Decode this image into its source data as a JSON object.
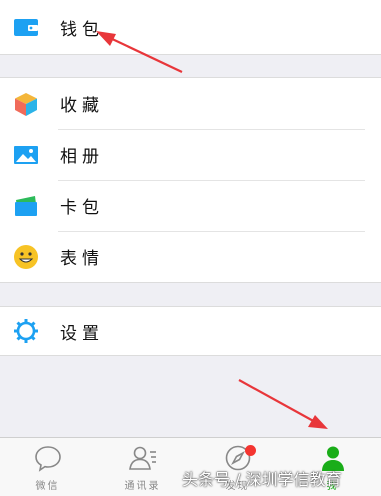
{
  "menu": {
    "wallet": {
      "label": "钱包",
      "icon": "wallet-icon"
    },
    "favorites": {
      "label": "收藏",
      "icon": "favorites-cube-icon"
    },
    "album": {
      "label": "相册",
      "icon": "album-picture-icon"
    },
    "cards": {
      "label": "卡包",
      "icon": "card-holder-icon"
    },
    "stickers": {
      "label": "表情",
      "icon": "smiley-icon"
    },
    "settings": {
      "label": "设置",
      "icon": "gear-icon"
    }
  },
  "tabbar": {
    "tabs": [
      {
        "label": "微信",
        "icon": "chat-bubble-icon",
        "active": false
      },
      {
        "label": "通讯录",
        "icon": "contacts-icon",
        "active": false
      },
      {
        "label": "发现",
        "icon": "compass-icon",
        "active": false,
        "badge": true
      },
      {
        "label": "我",
        "icon": "person-icon",
        "active": true
      }
    ]
  },
  "watermark": "头条号 / 深圳学信教育",
  "colors": {
    "accent": "#1aad19",
    "icon_blue": "#1da1f2",
    "badge": "#f43530",
    "arrow": "#e8363a",
    "background": "#efeff4"
  }
}
